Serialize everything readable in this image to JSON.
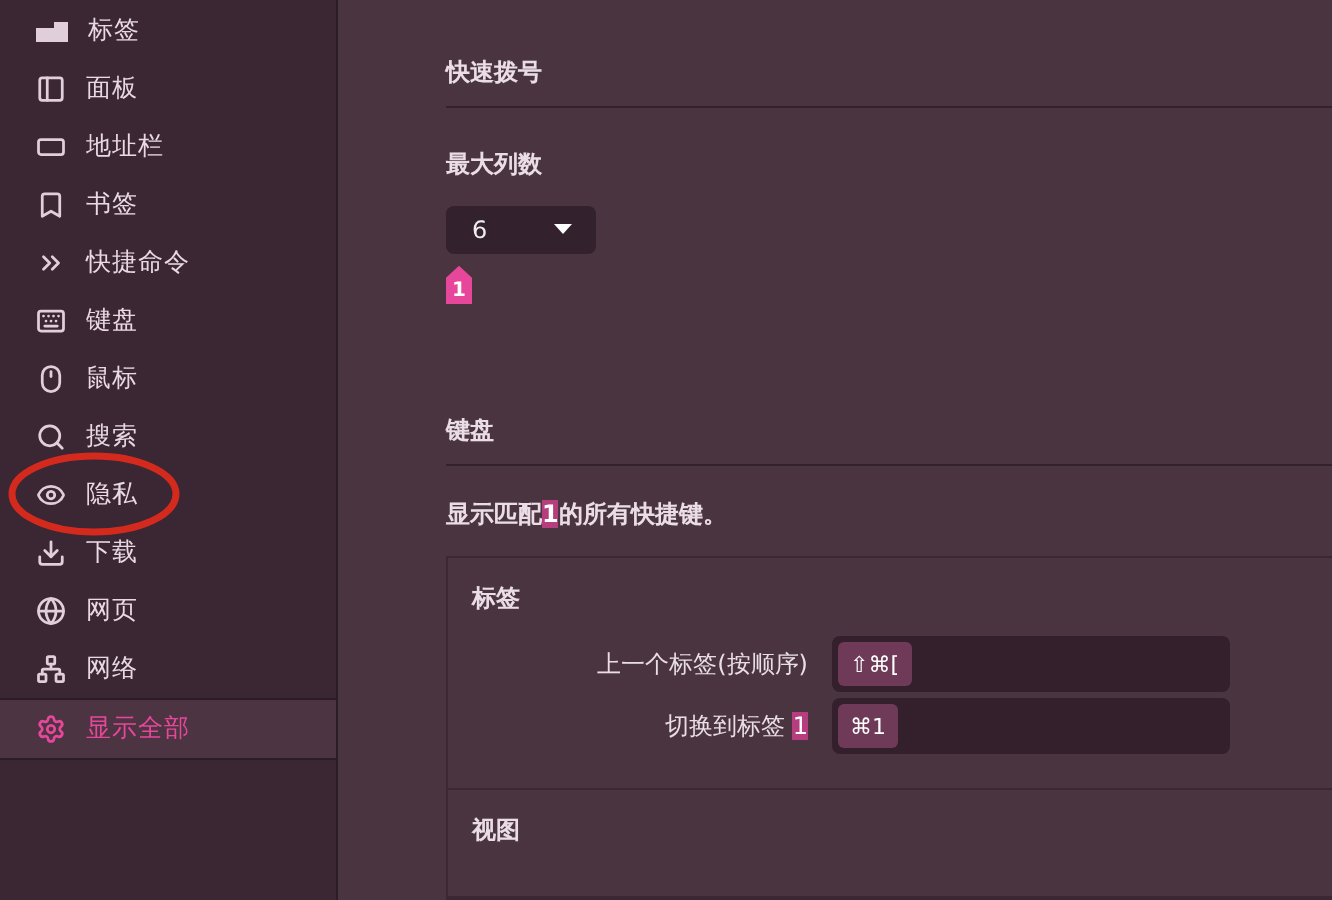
{
  "sidebar": {
    "items": [
      {
        "label": "标签",
        "selected": false,
        "circled": false
      },
      {
        "label": "面板",
        "selected": false,
        "circled": false
      },
      {
        "label": "地址栏",
        "selected": false,
        "circled": false
      },
      {
        "label": "书签",
        "selected": false,
        "circled": false
      },
      {
        "label": "快捷命令",
        "selected": false,
        "circled": false
      },
      {
        "label": "键盘",
        "selected": false,
        "circled": false
      },
      {
        "label": "鼠标",
        "selected": false,
        "circled": false
      },
      {
        "label": "搜索",
        "selected": false,
        "circled": false
      },
      {
        "label": "隐私",
        "selected": false,
        "circled": true
      },
      {
        "label": "下载",
        "selected": false,
        "circled": false
      },
      {
        "label": "网页",
        "selected": false,
        "circled": false
      },
      {
        "label": "网络",
        "selected": false,
        "circled": false
      },
      {
        "label": "显示全部",
        "selected": true,
        "circled": false
      }
    ]
  },
  "speed_dial": {
    "title": "快速拨号",
    "setting_label": "最大列数",
    "select_value": "6",
    "match_tag": "1"
  },
  "keyboard": {
    "title": "键盘",
    "summary": {
      "before": "显示匹配",
      "match": "1",
      "after": "的所有快捷键。"
    },
    "groups": [
      {
        "title": "标签",
        "shortcuts": [
          {
            "label_before": "上一个标签(按顺序)",
            "keys": "⇧⌘["
          },
          {
            "label_before": "切换到标签 ",
            "label_match": "1",
            "keys": "⌘1"
          }
        ]
      },
      {
        "title": "视图"
      }
    ]
  }
}
